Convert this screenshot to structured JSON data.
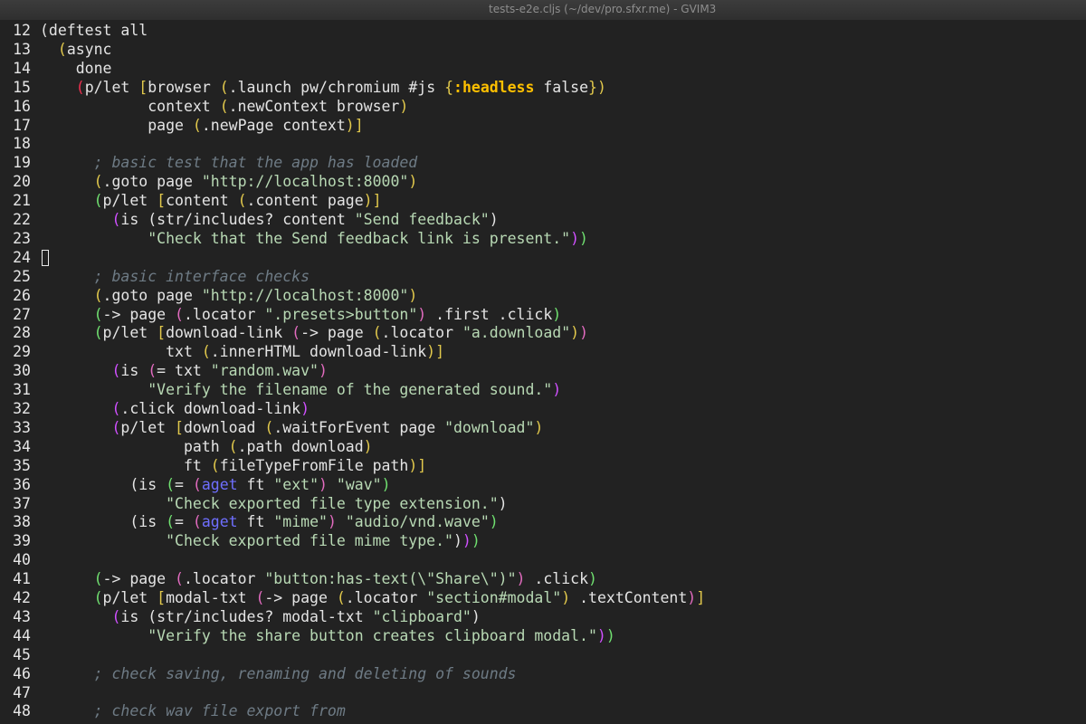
{
  "window": {
    "title": "tests-e2e.cljs (~/dev/pro.sfxr.me) - GVIM3"
  },
  "editor": {
    "lines": [
      {
        "n": "12",
        "parts": [
          [
            "t",
            "(deftest all"
          ]
        ]
      },
      {
        "n": "13",
        "parts": [
          [
            "t",
            "  "
          ],
          [
            "py",
            "("
          ],
          [
            "t",
            "async"
          ]
        ]
      },
      {
        "n": "14",
        "parts": [
          [
            "t",
            "    done"
          ]
        ]
      },
      {
        "n": "15",
        "parts": [
          [
            "t",
            "    "
          ],
          [
            "pr",
            "("
          ],
          [
            "t",
            "p/let "
          ],
          [
            "py",
            "["
          ],
          [
            "t",
            "browser "
          ],
          [
            "py",
            "("
          ],
          [
            "t",
            ".launch pw/chromium #js "
          ],
          [
            "py",
            "{"
          ],
          [
            "kw",
            ":headless"
          ],
          [
            "t",
            " false"
          ],
          [
            "py",
            "}"
          ],
          [
            "py",
            ")"
          ]
        ]
      },
      {
        "n": "16",
        "parts": [
          [
            "t",
            "            context "
          ],
          [
            "py",
            "("
          ],
          [
            "t",
            ".newContext browser"
          ],
          [
            "py",
            ")"
          ]
        ]
      },
      {
        "n": "17",
        "parts": [
          [
            "t",
            "            page "
          ],
          [
            "py",
            "("
          ],
          [
            "t",
            ".newPage context"
          ],
          [
            "py",
            ")"
          ],
          [
            "py",
            "]"
          ]
        ]
      },
      {
        "n": "18",
        "parts": []
      },
      {
        "n": "19",
        "parts": [
          [
            "cm",
            "      ; basic test that the app has loaded"
          ]
        ]
      },
      {
        "n": "20",
        "parts": [
          [
            "t",
            "      "
          ],
          [
            "py",
            "("
          ],
          [
            "t",
            ".goto page "
          ],
          [
            "s",
            "\"http://localhost:8000\""
          ],
          [
            "py",
            ")"
          ]
        ]
      },
      {
        "n": "21",
        "parts": [
          [
            "t",
            "      "
          ],
          [
            "pg",
            "("
          ],
          [
            "t",
            "p/let "
          ],
          [
            "py",
            "["
          ],
          [
            "t",
            "content "
          ],
          [
            "py",
            "("
          ],
          [
            "t",
            ".content page"
          ],
          [
            "py",
            ")"
          ],
          [
            "py",
            "]"
          ]
        ]
      },
      {
        "n": "22",
        "parts": [
          [
            "t",
            "        "
          ],
          [
            "pm",
            "("
          ],
          [
            "t",
            "is "
          ],
          [
            "t",
            "(str/includes? content "
          ],
          [
            "s",
            "\"Send feedback\""
          ],
          [
            "t",
            ")"
          ]
        ]
      },
      {
        "n": "23",
        "parts": [
          [
            "t",
            "            "
          ],
          [
            "s",
            "\"Check that the Send feedback link is present.\""
          ],
          [
            "pm",
            ")"
          ],
          [
            "pg",
            ")"
          ]
        ]
      },
      {
        "n": "24",
        "parts": [],
        "cursor": true
      },
      {
        "n": "25",
        "parts": [
          [
            "cm",
            "      ; basic interface checks"
          ]
        ]
      },
      {
        "n": "26",
        "parts": [
          [
            "t",
            "      "
          ],
          [
            "py",
            "("
          ],
          [
            "t",
            ".goto page "
          ],
          [
            "s",
            "\"http://localhost:8000\""
          ],
          [
            "py",
            ")"
          ]
        ]
      },
      {
        "n": "27",
        "parts": [
          [
            "t",
            "      "
          ],
          [
            "pg",
            "("
          ],
          [
            "t",
            "-> page "
          ],
          [
            "pk",
            "("
          ],
          [
            "t",
            ".locator "
          ],
          [
            "s",
            "\".presets>button\""
          ],
          [
            "pk",
            ")"
          ],
          [
            "t",
            " .first .click"
          ],
          [
            "pg",
            ")"
          ]
        ]
      },
      {
        "n": "28",
        "parts": [
          [
            "t",
            "      "
          ],
          [
            "pg",
            "("
          ],
          [
            "t",
            "p/let "
          ],
          [
            "py",
            "["
          ],
          [
            "t",
            "download-link "
          ],
          [
            "pk",
            "("
          ],
          [
            "t",
            "-> page "
          ],
          [
            "py",
            "("
          ],
          [
            "t",
            ".locator "
          ],
          [
            "s",
            "\"a.download\""
          ],
          [
            "py",
            ")"
          ],
          [
            "pk",
            ")"
          ]
        ]
      },
      {
        "n": "29",
        "parts": [
          [
            "t",
            "              txt "
          ],
          [
            "py",
            "("
          ],
          [
            "t",
            ".innerHTML download-link"
          ],
          [
            "py",
            ")"
          ],
          [
            "py",
            "]"
          ]
        ]
      },
      {
        "n": "30",
        "parts": [
          [
            "t",
            "        "
          ],
          [
            "pm",
            "("
          ],
          [
            "t",
            "is "
          ],
          [
            "pk",
            "("
          ],
          [
            "t",
            "= txt "
          ],
          [
            "s",
            "\"random.wav\""
          ],
          [
            "pk",
            ")"
          ]
        ]
      },
      {
        "n": "31",
        "parts": [
          [
            "t",
            "            "
          ],
          [
            "s",
            "\"Verify the filename of the generated sound.\""
          ],
          [
            "pm",
            ")"
          ]
        ]
      },
      {
        "n": "32",
        "parts": [
          [
            "t",
            "        "
          ],
          [
            "pm",
            "("
          ],
          [
            "t",
            ".click download-link"
          ],
          [
            "pm",
            ")"
          ]
        ]
      },
      {
        "n": "33",
        "parts": [
          [
            "t",
            "        "
          ],
          [
            "pm",
            "("
          ],
          [
            "t",
            "p/let "
          ],
          [
            "py",
            "["
          ],
          [
            "t",
            "download "
          ],
          [
            "py",
            "("
          ],
          [
            "t",
            ".waitForEvent page "
          ],
          [
            "s",
            "\"download\""
          ],
          [
            "py",
            ")"
          ]
        ]
      },
      {
        "n": "34",
        "parts": [
          [
            "t",
            "                path "
          ],
          [
            "py",
            "("
          ],
          [
            "t",
            ".path download"
          ],
          [
            "py",
            ")"
          ]
        ]
      },
      {
        "n": "35",
        "parts": [
          [
            "t",
            "                ft "
          ],
          [
            "py",
            "("
          ],
          [
            "t",
            "fileTypeFromFile path"
          ],
          [
            "py",
            ")"
          ],
          [
            "py",
            "]"
          ]
        ]
      },
      {
        "n": "36",
        "parts": [
          [
            "t",
            "          "
          ],
          [
            "t",
            "(is "
          ],
          [
            "pg",
            "("
          ],
          [
            "t",
            "= "
          ],
          [
            "pk",
            "("
          ],
          [
            "fn",
            "aget"
          ],
          [
            "t",
            " ft "
          ],
          [
            "s",
            "\"ext\""
          ],
          [
            "pk",
            ")"
          ],
          [
            "t",
            " "
          ],
          [
            "s",
            "\"wav\""
          ],
          [
            "pg",
            ")"
          ]
        ]
      },
      {
        "n": "37",
        "parts": [
          [
            "t",
            "              "
          ],
          [
            "s",
            "\"Check exported file type extension.\""
          ],
          [
            "t",
            ")"
          ]
        ]
      },
      {
        "n": "38",
        "parts": [
          [
            "t",
            "          "
          ],
          [
            "t",
            "(is "
          ],
          [
            "pg",
            "("
          ],
          [
            "t",
            "= "
          ],
          [
            "pk",
            "("
          ],
          [
            "fn",
            "aget"
          ],
          [
            "t",
            " ft "
          ],
          [
            "s",
            "\"mime\""
          ],
          [
            "pk",
            ")"
          ],
          [
            "t",
            " "
          ],
          [
            "s",
            "\"audio/vnd.wave\""
          ],
          [
            "pg",
            ")"
          ]
        ]
      },
      {
        "n": "39",
        "parts": [
          [
            "t",
            "              "
          ],
          [
            "s",
            "\"Check exported file mime type.\""
          ],
          [
            "t",
            ")"
          ],
          [
            "pm",
            ")"
          ],
          [
            "pg",
            ")"
          ]
        ]
      },
      {
        "n": "40",
        "parts": []
      },
      {
        "n": "41",
        "parts": [
          [
            "t",
            "      "
          ],
          [
            "pg",
            "("
          ],
          [
            "t",
            "-> page "
          ],
          [
            "pk",
            "("
          ],
          [
            "t",
            ".locator "
          ],
          [
            "s",
            "\"button:has-text(\\\"Share\\\")\""
          ],
          [
            "pk",
            ")"
          ],
          [
            "t",
            " .click"
          ],
          [
            "pg",
            ")"
          ]
        ]
      },
      {
        "n": "42",
        "parts": [
          [
            "t",
            "      "
          ],
          [
            "pg",
            "("
          ],
          [
            "t",
            "p/let "
          ],
          [
            "py",
            "["
          ],
          [
            "t",
            "modal-txt "
          ],
          [
            "pk",
            "("
          ],
          [
            "t",
            "-> page "
          ],
          [
            "py",
            "("
          ],
          [
            "t",
            ".locator "
          ],
          [
            "s",
            "\"section#modal\""
          ],
          [
            "py",
            ")"
          ],
          [
            "t",
            " .textContent"
          ],
          [
            "pk",
            ")"
          ],
          [
            "py",
            "]"
          ]
        ]
      },
      {
        "n": "43",
        "parts": [
          [
            "t",
            "        "
          ],
          [
            "pm",
            "("
          ],
          [
            "t",
            "is "
          ],
          [
            "t",
            "(str/includes? modal-txt "
          ],
          [
            "s",
            "\"clipboard\""
          ],
          [
            "t",
            ")"
          ]
        ]
      },
      {
        "n": "44",
        "parts": [
          [
            "t",
            "            "
          ],
          [
            "s",
            "\"Verify the share button creates clipboard modal.\""
          ],
          [
            "pm",
            ")"
          ],
          [
            "pg",
            ")"
          ]
        ]
      },
      {
        "n": "45",
        "parts": []
      },
      {
        "n": "46",
        "parts": [
          [
            "cm",
            "      ; check saving, renaming and deleting of sounds"
          ]
        ]
      },
      {
        "n": "47",
        "parts": []
      },
      {
        "n": "48",
        "parts": [
          [
            "cm",
            "      ; check wav file export from"
          ]
        ]
      }
    ]
  },
  "colors": {
    "background": "#222222",
    "text": "#e3e3e3",
    "comment": "#6e7b85",
    "string": "#b8d9b4",
    "keyword": "#ffc000"
  }
}
